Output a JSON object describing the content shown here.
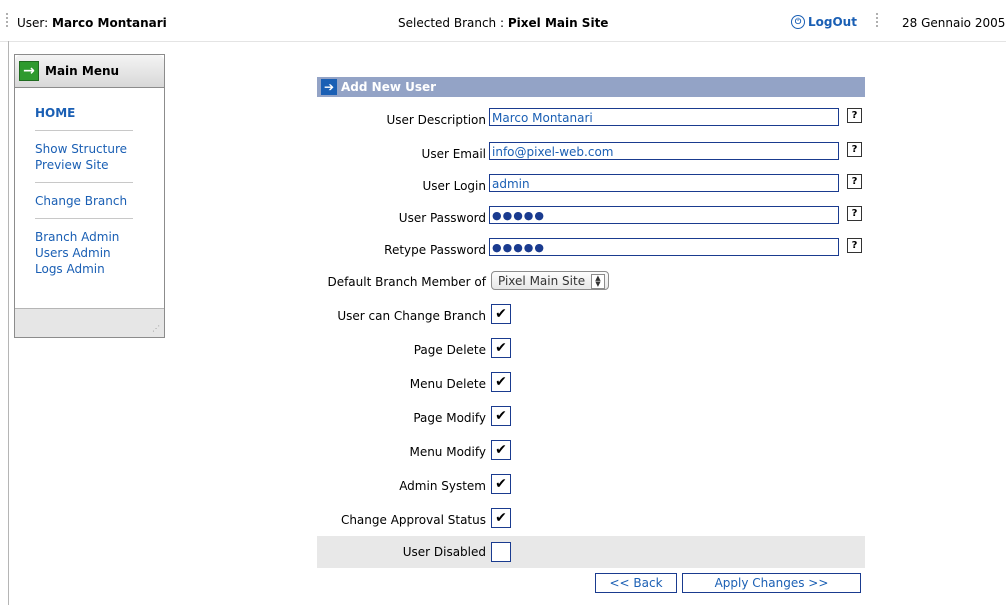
{
  "topbar": {
    "user_label": "User:",
    "user_name": "Marco Montanari",
    "branch_label": "Selected Branch :",
    "branch_name": "Pixel Main Site",
    "logout": "LogOut",
    "date": "28 Gennaio 2005"
  },
  "menu": {
    "title": "Main Menu",
    "items": [
      {
        "label": "HOME"
      },
      {
        "label": "Show Structure"
      },
      {
        "label": "Preview Site"
      },
      {
        "label": "Change Branch"
      },
      {
        "label": "Branch Admin"
      },
      {
        "label": "Users Admin"
      },
      {
        "label": "Logs Admin"
      }
    ]
  },
  "form": {
    "title": "Add New User",
    "fields": {
      "user_description": {
        "label": "User Description",
        "value": "Marco Montanari"
      },
      "user_email": {
        "label": "User Email",
        "value": "info@pixel-web.com"
      },
      "user_login": {
        "label": "User Login",
        "value": "admin"
      },
      "user_password": {
        "label": "User Password",
        "value": "●●●●●"
      },
      "retype_password": {
        "label": "Retype Password",
        "value": "●●●●●"
      },
      "default_branch": {
        "label": "Default Branch Member of",
        "value": "Pixel Main Site"
      }
    },
    "help_glyph": "?",
    "checkboxes": [
      {
        "label": "User can Change Branch",
        "checked": true
      },
      {
        "label": "Page Delete",
        "checked": true
      },
      {
        "label": "Menu Delete",
        "checked": true
      },
      {
        "label": "Page Modify",
        "checked": true
      },
      {
        "label": "Menu Modify",
        "checked": true
      },
      {
        "label": "Admin System",
        "checked": true
      },
      {
        "label": "Change Approval Status",
        "checked": true
      },
      {
        "label": "User Disabled",
        "checked": false
      }
    ],
    "back_button": "<< Back",
    "apply_button": "Apply Changes >>"
  },
  "colors": {
    "link": "#1a5fb4",
    "header_bar": "#93a3c6",
    "input_border": "#1a3b8f"
  }
}
